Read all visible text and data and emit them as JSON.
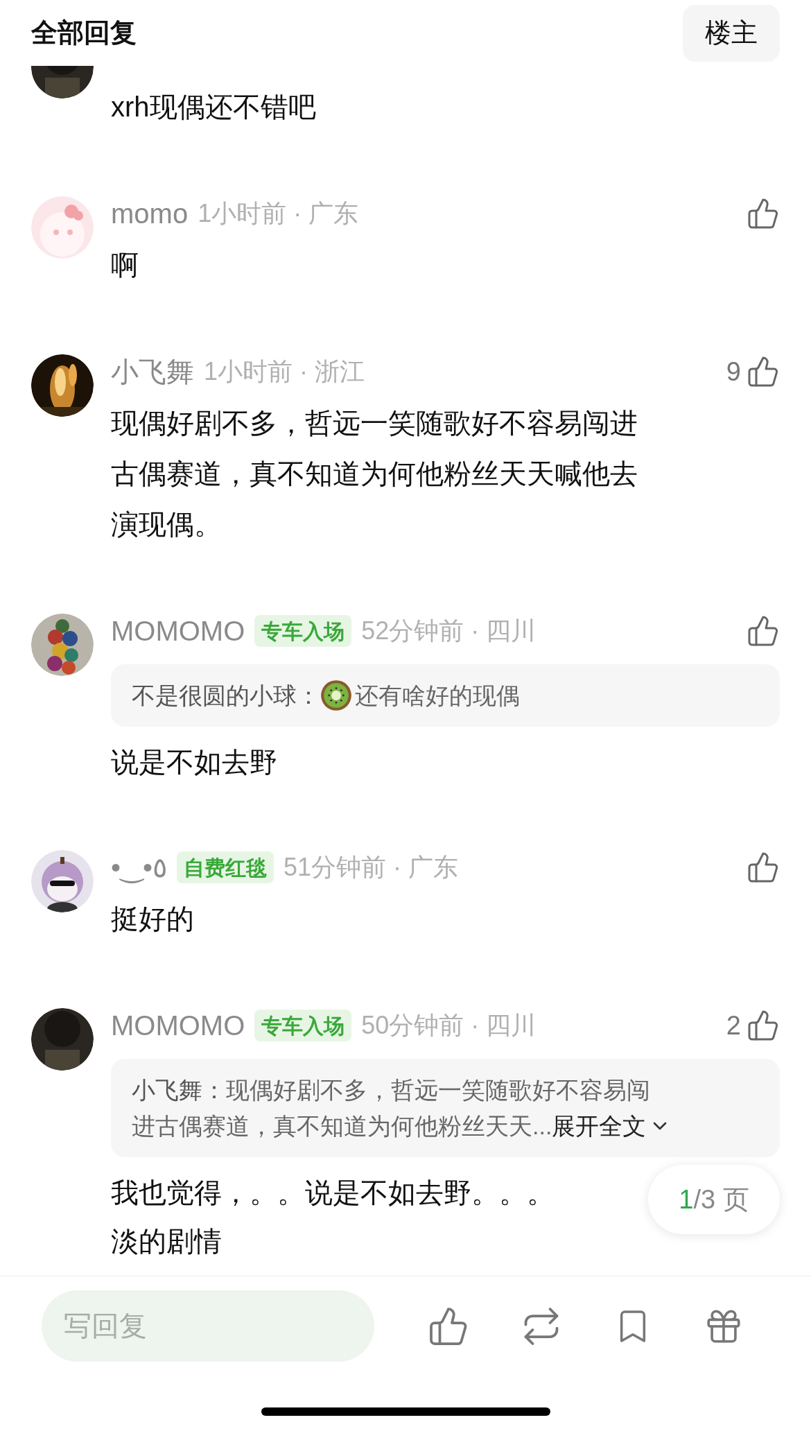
{
  "header": {
    "title": "全部回复",
    "owner_button": "楼主"
  },
  "comments": [
    {
      "text_lines": [
        "xrh现偶还不错吧"
      ]
    },
    {
      "name": "momo",
      "meta": "1小时前 · 广东",
      "text_lines": [
        "啊"
      ]
    },
    {
      "name": "小飞舞",
      "meta": "1小时前 · 浙江",
      "likes": "9",
      "text_lines": [
        "现偶好剧不多，哲远一笑随歌好不容易闯进",
        "古偶赛道，真不知道为何他粉丝天天喊他去",
        "演现偶。"
      ]
    },
    {
      "name": "MOMOMO",
      "badge": "专车入场",
      "meta": "52分钟前 · 四川",
      "quote": {
        "author": "不是很圆的小球：",
        "kiwi": true,
        "lines": [
          "还有啥好的现偶"
        ]
      },
      "text_lines": [
        "说是不如去野"
      ]
    },
    {
      "name": "•‿•٥",
      "badge": "自费红毯",
      "meta": "51分钟前 · 广东",
      "text_lines": [
        "挺好的"
      ]
    },
    {
      "name": "MOMOMO",
      "badge": "专车入场",
      "meta": "50分钟前 · 四川",
      "likes": "2",
      "quote": {
        "author": "小飞舞：",
        "kiwi": false,
        "lines": [
          "现偶好剧不多，哲远一笑随歌好不容易闯",
          "进古偶赛道，真不知道为何他粉丝天天..."
        ],
        "expand": "展开全文"
      },
      "text_lines": [
        "我也觉得，。。说是不如去野。。。",
        "淡的剧情"
      ]
    }
  ],
  "pager": {
    "current": "1",
    "rest": "/3 页"
  },
  "reply_bar": {
    "placeholder": "写回复"
  }
}
